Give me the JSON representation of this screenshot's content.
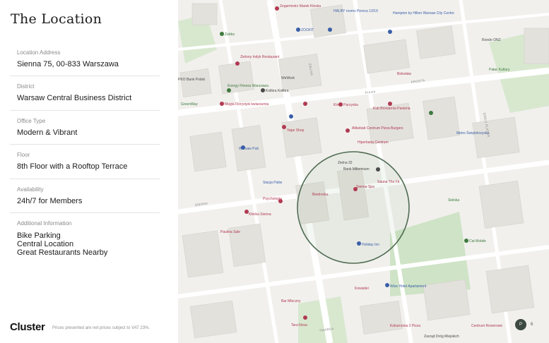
{
  "title": "The Location",
  "fields": [
    {
      "label": "Location Address",
      "value": "Sienna 75, 00-833 Warszawa"
    },
    {
      "label": "District",
      "value": "Warsaw Central Business District"
    },
    {
      "label": "Office Type",
      "value": "Modern & Vibrant"
    },
    {
      "label": "Floor",
      "value": "8th Floor with a Rooftop Terrace"
    },
    {
      "label": "Availability",
      "value": "24h/7 for Members"
    }
  ],
  "additional": {
    "label": "Additional Information",
    "lines": [
      "Bike Parking",
      "Central Location",
      "Great Restaurants Nearby"
    ]
  },
  "footer": {
    "logo": "Cluster",
    "note": "Prices presented are net prices subject to VAT 23%."
  },
  "map": {
    "pois": [
      {
        "name": "Żabka",
        "color": "#3f7a3f"
      },
      {
        "name": "Zegarmistrz Marek Kłoska",
        "color": "#b13a52"
      },
      {
        "name": "HALBY rooms Pereca 13/19",
        "color": "#3a5fa8"
      },
      {
        "name": "ZOOFIT",
        "color": "#3a5fa8"
      },
      {
        "name": "Hampton by Hilton Warsaw City Centre",
        "color": "#3a5fa8"
      },
      {
        "name": "Rondo ONZ",
        "color": "#4a4a4a"
      },
      {
        "name": "Zielony Indyk Restaurant",
        "color": "#b13a52"
      },
      {
        "name": "WeWork",
        "color": "#4a4a4a"
      },
      {
        "name": "PKO Bank Polski",
        "color": "#4a4a4a"
      },
      {
        "name": "Energy Fitness Warszawa",
        "color": "#3f7a3f"
      },
      {
        "name": "Kolibra Kolibra",
        "color": "#4a4a4a"
      },
      {
        "name": "Magia Florystyki kwiaciarnia",
        "color": "#b13a52"
      },
      {
        "name": "Bolesław",
        "color": "#b13a52"
      },
      {
        "name": "Prosta",
        "color": "#8a8a8a"
      },
      {
        "name": "GreenWay",
        "color": "#3f7a3f"
      },
      {
        "name": "Kineo Parzyska",
        "color": "#b13a52"
      },
      {
        "name": "Kub Browarnia Pasteria",
        "color": "#b13a52"
      },
      {
        "name": "Vape Shop",
        "color": "#b13a52"
      },
      {
        "name": "Altkebab Centrum Pizza Burgers",
        "color": "#b13a52"
      },
      {
        "name": "Hiperbaria Centrum",
        "color": "#b13a52"
      },
      {
        "name": "Zielna 32",
        "color": "#4a4a4a"
      },
      {
        "name": "Warsaw Pub",
        "color": "#3a5fa8"
      },
      {
        "name": "Bank Millennium",
        "color": "#4a4a4a"
      },
      {
        "name": "Stacja Paliw",
        "color": "#3a5fa8"
      },
      {
        "name": "Psychologia",
        "color": "#b13a52"
      },
      {
        "name": "Klinika Sienna",
        "color": "#b13a52"
      },
      {
        "name": "Sienna Spa",
        "color": "#b13a52"
      },
      {
        "name": "Sauna The Fit",
        "color": "#b13a52"
      },
      {
        "name": "Biedronka",
        "color": "#b13a52"
      },
      {
        "name": "Holiday Inn",
        "color": "#3a5fa8"
      },
      {
        "name": "Cat Mobile",
        "color": "#3f7a3f"
      },
      {
        "name": "Sielska",
        "color": "#3f7a3f"
      },
      {
        "name": "Paulina Sale",
        "color": "#b13a52"
      },
      {
        "name": "Wise Hotel Apartament",
        "color": "#3a5fa8"
      },
      {
        "name": "Bar Mleczny",
        "color": "#b13a52"
      },
      {
        "name": "Kowalski",
        "color": "#b13a52"
      },
      {
        "name": "Tara Nova",
        "color": "#b13a52"
      },
      {
        "name": "Centrum Rowerowe",
        "color": "#b13a52"
      },
      {
        "name": "Kokurnoina 2 Pizza",
        "color": "#b13a52"
      },
      {
        "name": "Zarząd Dróg Miejskich",
        "color": "#4a4a4a"
      },
      {
        "name": "Metro Świętokrzyska",
        "color": "#3a5fa8"
      },
      {
        "name": "Pałac Kultury",
        "color": "#3f7a3f"
      }
    ],
    "streets": [
      "PROSTA",
      "TWARDA",
      "SIENNA",
      "ZIELNA",
      "EMILII PLATER"
    ],
    "zoom_button": "P",
    "zoom_count": "6"
  }
}
